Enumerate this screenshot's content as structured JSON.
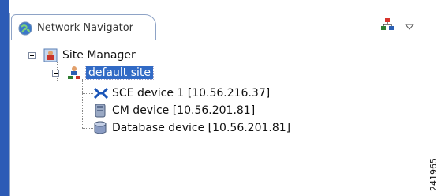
{
  "tab": {
    "title": "Network Navigator",
    "icon": "globe-icon"
  },
  "toolbar": {
    "topology_icon": "network-topology-icon",
    "menu_icon": "view-menu-icon"
  },
  "tree": {
    "root": {
      "label": "Site Manager",
      "icon": "site-manager-icon",
      "expanded": true
    },
    "site": {
      "label": "default site",
      "icon": "site-icon",
      "expanded": true,
      "selected": true
    },
    "devices": [
      {
        "label": "SCE device 1 [10.56.216.37]",
        "icon": "sce-device-icon"
      },
      {
        "label": "CM device [10.56.201.81]",
        "icon": "cm-device-icon"
      },
      {
        "label": "Database  device [10.56.201.81]",
        "icon": "database-icon"
      }
    ]
  },
  "figure_id": "241965",
  "colors": {
    "selection": "#316ac5",
    "frame": "#2c5bb6",
    "tab_border": "#8ea3c6"
  }
}
